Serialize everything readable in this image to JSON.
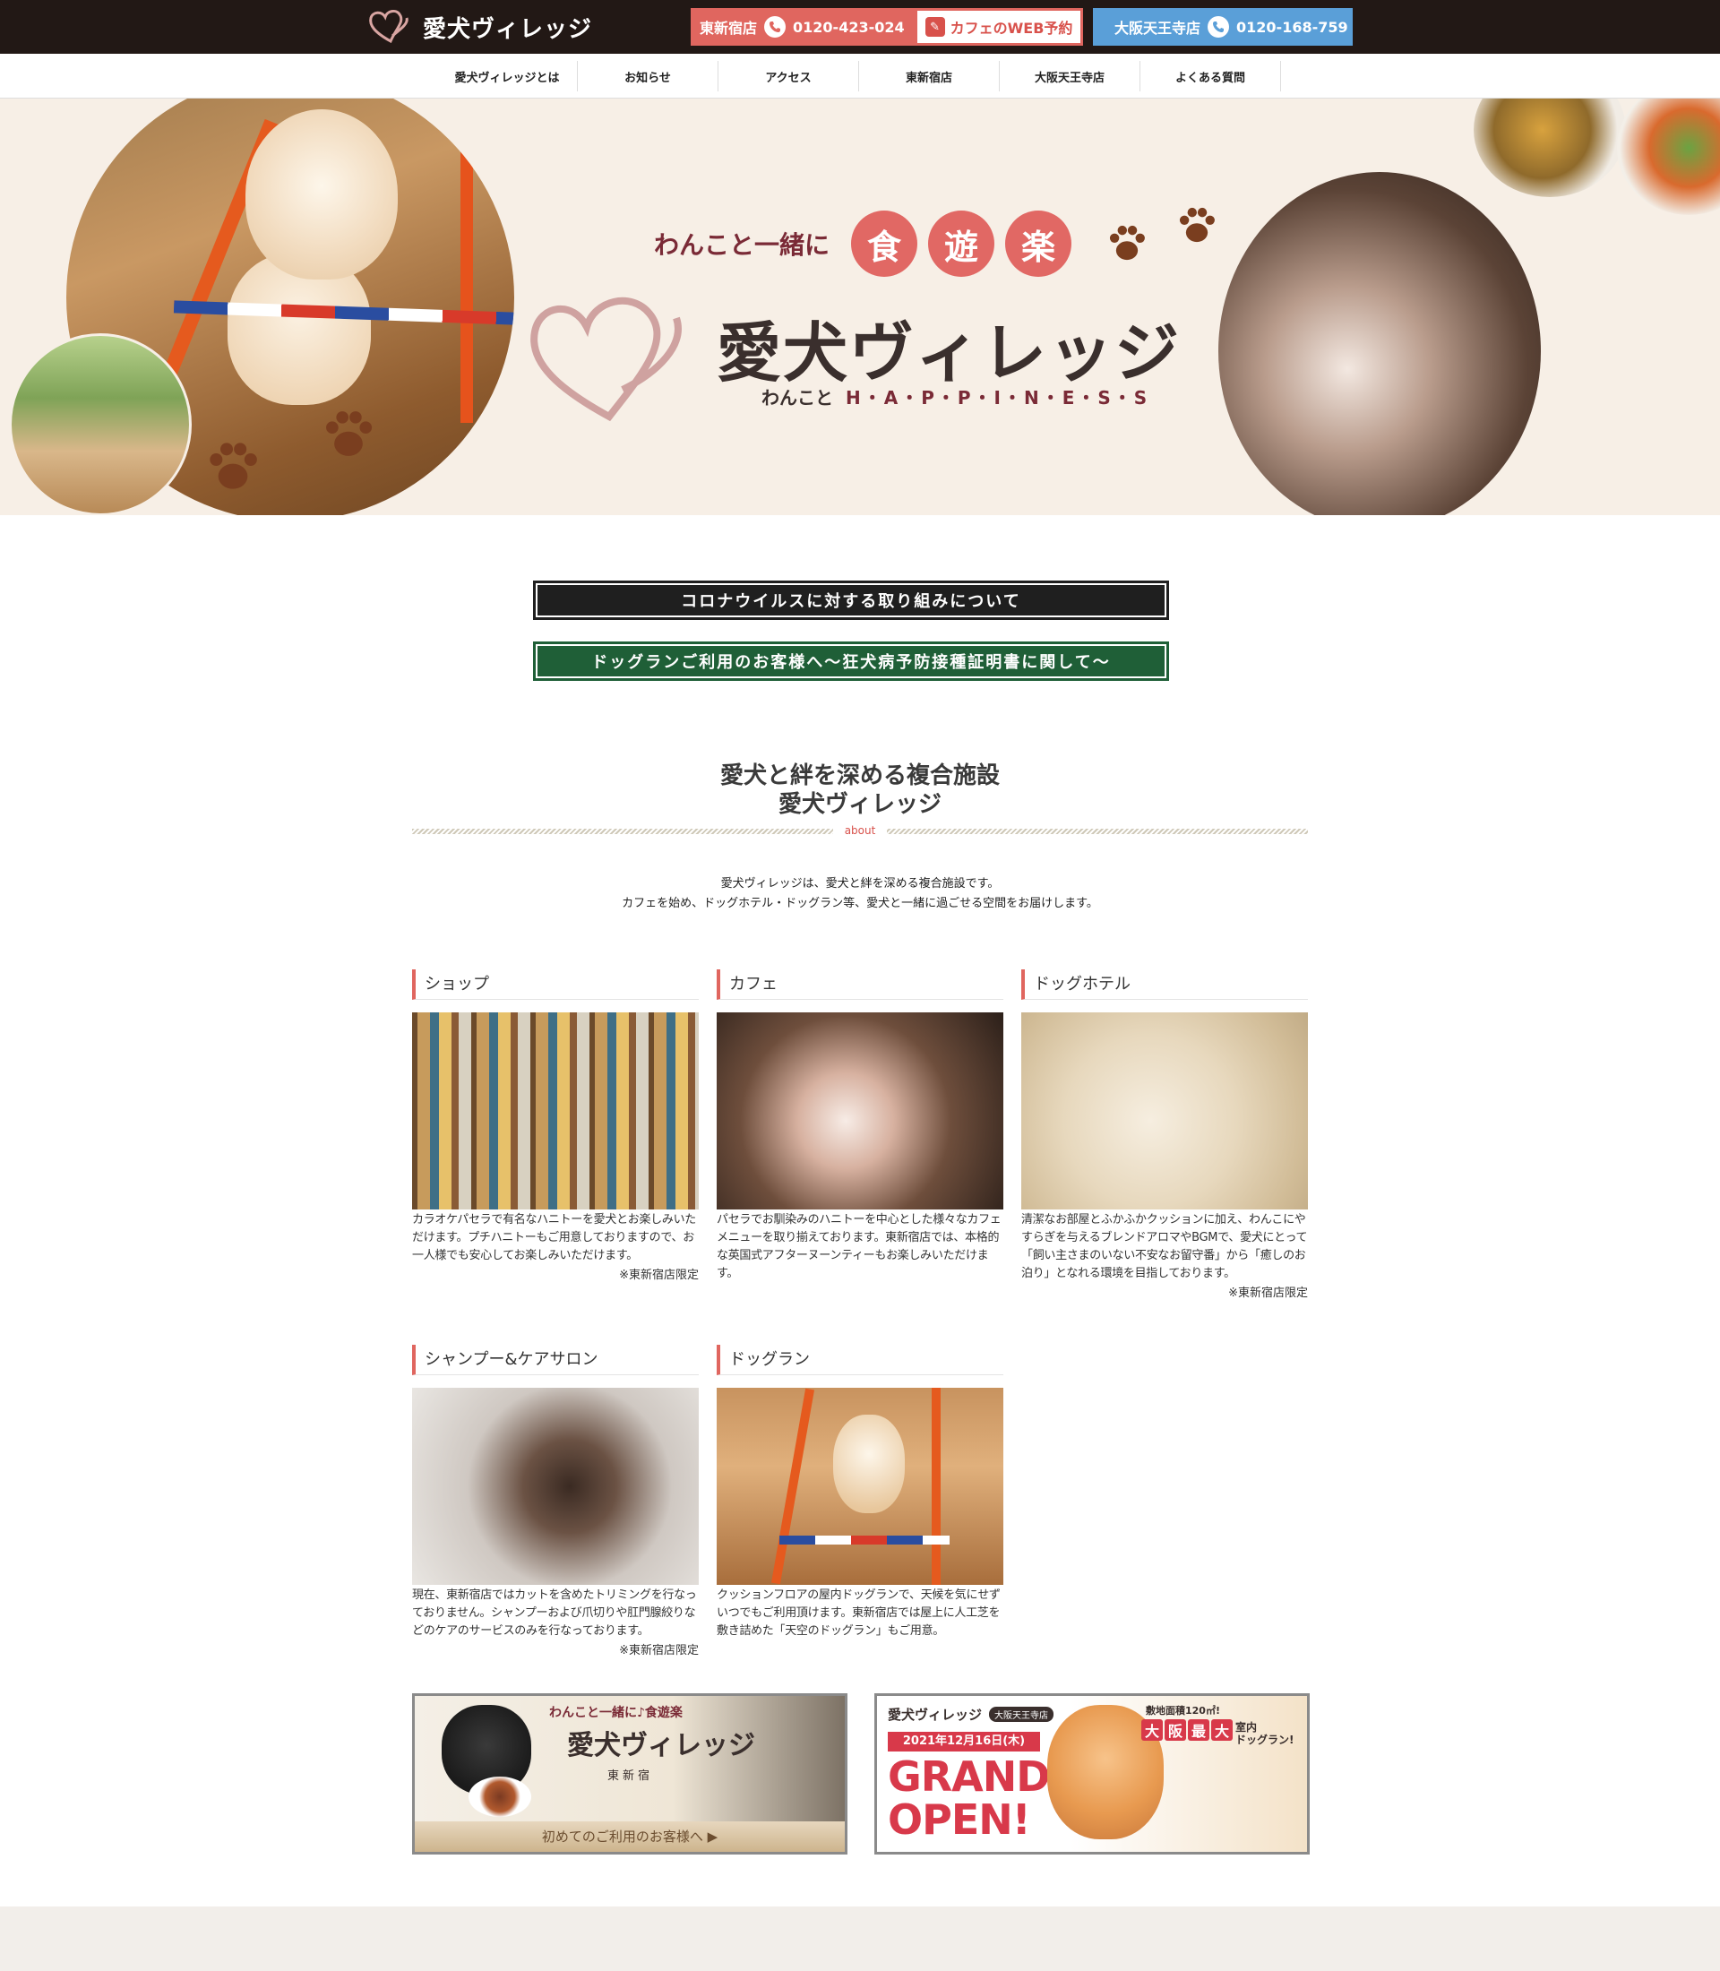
{
  "header": {
    "logo_text": "愛犬ヴィレッジ",
    "shinshinjuku": {
      "label": "東新宿店",
      "phone": "0120-423-024"
    },
    "web_reserve": "カフェのWEB予約",
    "osaka": {
      "label": "大阪天王寺店",
      "phone": "0120-168-759"
    }
  },
  "nav": {
    "items": [
      "愛犬ヴィレッジとは",
      "お知らせ",
      "アクセス",
      "東新宿店",
      "大阪天王寺店",
      "よくある質問"
    ]
  },
  "hero": {
    "tagline": "わんこと一緒に",
    "kanji": [
      "食",
      "遊",
      "楽"
    ],
    "title": "愛犬ヴィレッジ",
    "sub_prefix": "わんこと",
    "sub_happiness": "H・A・P・P・I・N・E・S・S"
  },
  "notices": {
    "corona": "コロナウイルスに対する取り組みについて",
    "dogrun": "ドッグランご利用のお客様へ〜狂犬病予防接種証明書に関して〜"
  },
  "about": {
    "title_line1": "愛犬と絆を深める複合施設",
    "title_line2": "愛犬ヴィレッジ",
    "label": "about",
    "desc_line1": "愛犬ヴィレッジは、愛犬と絆を深める複合施設です。",
    "desc_line2": "カフェを始め、ドッグホテル・ドッグラン等、愛犬と一緒に過ごせる空間をお届けします。"
  },
  "services": [
    {
      "title": "ショップ",
      "desc": "カラオケパセラで有名なハニトーを愛犬とお楽しみいただけます。プチハニトーもご用意しておりますので、お一人様でも安心してお楽しみいただけます。",
      "note": "※東新宿店限定"
    },
    {
      "title": "カフェ",
      "desc": "パセラでお馴染みのハニトーを中心とした様々なカフェメニューを取り揃えております。東新宿店では、本格的な英国式アフターヌーンティーもお楽しみいただけます。",
      "note": ""
    },
    {
      "title": "ドッグホテル",
      "desc": "清潔なお部屋とふかふかクッションに加え、わんこにやすらぎを与えるブレンドアロマやBGMで、愛犬にとって「飼い主さまのいない不安なお留守番」から「癒しのお泊り」となれる環境を目指しております。",
      "note": "※東新宿店限定"
    },
    {
      "title": "シャンプー&ケアサロン",
      "desc": "現在、東新宿店ではカットを含めたトリミングを行なっておりません。シャンプーおよび爪切りや肛門腺絞りなどのケアのサービスのみを行なっております。",
      "note": "※東新宿店限定"
    },
    {
      "title": "ドッグラン",
      "desc": "クッションフロアの屋内ドッグランで、天候を気にせずいつでもご利用頂けます。東新宿店では屋上に人工芝を敷き詰めた「天空のドッグラン」もご用意。",
      "note": ""
    }
  ],
  "banners": {
    "first": {
      "tag": "わんこと一緒に♪食遊楽",
      "logo": "愛犬ヴィレッジ",
      "store": "東新宿",
      "footer": "初めてのご利用のお客様へ ▶"
    },
    "osaka": {
      "logo": "愛犬ヴィレッジ",
      "badge": "大阪天王寺店",
      "date": "2021年12月16日(木)",
      "grand": "GRAND",
      "open": "OPEN!",
      "area": "敷地面積120㎡!",
      "big": [
        "大",
        "阪",
        "最",
        "大"
      ],
      "run_line1": "室内",
      "run_line2": "ドッグラン!"
    }
  }
}
